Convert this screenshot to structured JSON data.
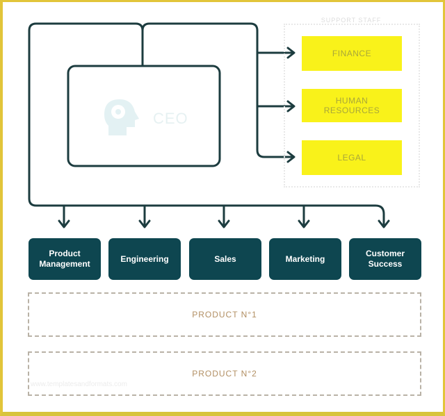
{
  "diagram": {
    "executive": {
      "label": "CEO",
      "icon": "head-gear-icon"
    },
    "staff_group": {
      "title": "SUPPORT STAFF",
      "units": [
        {
          "label": "FINANCE"
        },
        {
          "label": "HUMAN RESOURCES"
        },
        {
          "label": "LEGAL"
        }
      ]
    },
    "departments": [
      {
        "label": "Product Management"
      },
      {
        "label": "Engineering"
      },
      {
        "label": "Sales"
      },
      {
        "label": "Marketing"
      },
      {
        "label": "Customer Success"
      }
    ],
    "products": [
      {
        "label": "PRODUCT N°1"
      },
      {
        "label": "PRODUCT N°2"
      }
    ],
    "watermark": "www.templatesandformats.com",
    "colors": {
      "frame": "#e2c53a",
      "line": "#1c3c3f",
      "department_fill": "#0e4650",
      "staff_fill": "#f9f21a",
      "staff_text": "#a9a73a",
      "product_text": "#b28f63",
      "product_border": "#b9b2a6"
    }
  }
}
